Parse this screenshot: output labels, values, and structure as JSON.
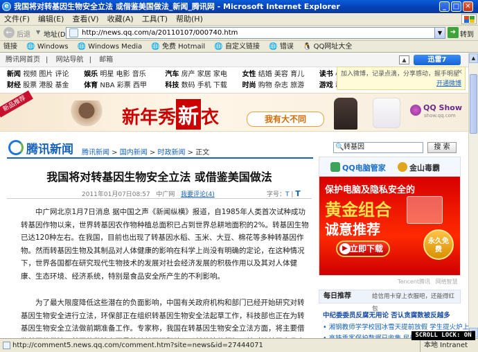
{
  "window": {
    "title": "我国将对转基因生物安全立法 或借鉴美国做法_新闻_腾讯网 - Microsoft Internet Explorer",
    "ie_icon": "e"
  },
  "menu": [
    "文件(F)",
    "编辑(E)",
    "查看(V)",
    "收藏(A)",
    "工具(T)",
    "帮助(H)"
  ],
  "toolbar": {
    "back_label": "后退",
    "address_label": "地址(D)",
    "address_value": "http://news.qq.com/a/20110107/000740.htm",
    "go_label": "转到"
  },
  "links": {
    "label": "链接",
    "items": [
      "Windows",
      "Windows Media",
      "免费 Hotmail",
      "自定义链接",
      "错误",
      "QQ网址大全"
    ]
  },
  "qqtop": {
    "items": [
      "腾讯网首页",
      "网站导航",
      "邮箱"
    ],
    "weibo": "迅雷7"
  },
  "nav": {
    "row1": [
      {
        "b": "新闻",
        "rest": "视频 图片 评论"
      },
      {
        "b": "娱乐",
        "rest": "明星 电影 音乐"
      },
      {
        "b": "汽车",
        "rest": "房产 家居 家电"
      },
      {
        "b": "女性",
        "rest": "结婚 美容 育儿"
      },
      {
        "b": "读书",
        "rest": "小说"
      }
    ],
    "row2": [
      {
        "b": "财经",
        "rest": "股票 港股 基金"
      },
      {
        "b": "体育",
        "rest": "NBA 彩票 西甲"
      },
      {
        "b": "科技",
        "rest": "数码 手机 下载"
      },
      {
        "b": "时尚",
        "rest": "购物 杂志 旅游"
      },
      {
        "b": "游戏",
        "rest": "动漫"
      }
    ]
  },
  "popup": {
    "text": "加入微博，记录点滴，分享感动，握手明星",
    "link": "开通微博"
  },
  "banner": {
    "tag": "新品推荐",
    "headline_a": "新年秀",
    "headline_b": "新",
    "headline_c": "衣",
    "sub": "我有大不同",
    "brand": "QQ Show",
    "brand_url": "show.qq.com"
  },
  "site": {
    "logo": "腾讯新闻"
  },
  "breadcrumb": [
    "腾讯新闻",
    "国内新闻",
    "时政新闻",
    "正文"
  ],
  "search": {
    "value": "转基因",
    "button": "搜 索"
  },
  "article": {
    "title": "我国将对转基因生物安全立法 或借鉴美国做法",
    "date": "2011年01月07日08:57",
    "source": "中广网",
    "comments": "我要评论(4)",
    "fontsize_label": "字号：",
    "fontsize_small": "T",
    "fontsize_large": "T",
    "p1": "中广网北京1月7日消息 据中国之声《新闻纵横》报道，自1985年人类首次试种成功转基因作物以来，世界转基因农作物种植总面积已占到世界总耕地面积的2%。转基因生物已达120种左右。在我国，目前也出现了转基因水稻、玉米、大豆、棉花等多种转基因作物。然而转基因生物及其制品对人体健康的影响在科学上尚没有明确的定论，在这种情况下，世界各国都在研究现代生物技术的发展对社会经济发展的积极作用以及其对人体健康、生态环境、经济系统，特别是食品安全所产生的不利影响。",
    "p2": "为了最大限度降低这些潜在的负面影响，中国有关政府机构和部门已经开始研究对转基因生物安全进行立法，环保部正在组织转基因生物安全法起草工作，科技部也正在为转基因生物安全立法做前期准备工作。专家称，我国在转基因生物安全立法方面，将主要借鉴美国的做法，美国的做法主要是将转基因问题纳入以前的法律框架，并对转基因产品实施统一管理，不同部门负责不同的管理领域。"
  },
  "ad": {
    "brand1": "QQ电脑管家",
    "brand2": "金山毒霸",
    "line1": "保护电脑及隐私安全的",
    "line2": "黄金组合",
    "line3": "诚意推荐",
    "cta": "立即下载",
    "badge": "永久免费",
    "footer": "Tencent腾讯",
    "footer2": "网络智慧"
  },
  "daily": {
    "title": "每日推荐",
    "sub": "给信用卡穿上衣服吧，还能得红包",
    "items": [
      "中纪委委员反腐无用论  否认贪腐数被反越多",
      "• 湘钢教师学学校园冰雪天提前放假  学生提火炉上学",
      "• 高铁乘客保护数据已收集 民航机场"
    ]
  },
  "status": {
    "url": "http://comment5.news.qq.com/comment.htm?site=news&id=27444071",
    "zone": "本地 Intranet",
    "scroll_lock": "SCROLL LOCK: ON"
  },
  "colors": {
    "ie_blue": "#0a5cd8",
    "qq_red": "#d0021b",
    "link_blue": "#1662c0"
  }
}
